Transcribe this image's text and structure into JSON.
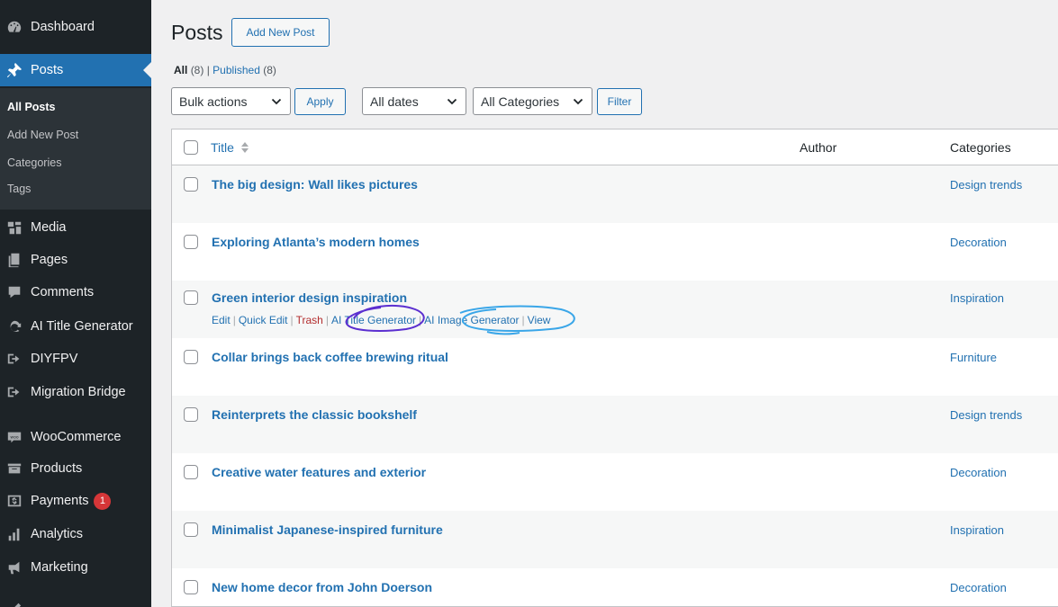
{
  "sidebar": {
    "items": [
      {
        "label": "Dashboard",
        "icon": "dashboard-icon"
      },
      {
        "label": "Posts",
        "icon": "pin-icon",
        "current": true
      },
      {
        "label": "Media",
        "icon": "media-icon"
      },
      {
        "label": "Pages",
        "icon": "pages-icon"
      },
      {
        "label": "Comments",
        "icon": "comments-icon"
      },
      {
        "label": "AI Title Generator",
        "icon": "refresh-icon"
      },
      {
        "label": "DIYFPV",
        "icon": "plugin-arrow-icon"
      },
      {
        "label": "Migration Bridge",
        "icon": "plugin-arrow-icon"
      },
      {
        "label": "WooCommerce",
        "icon": "woo-icon"
      },
      {
        "label": "Products",
        "icon": "archive-icon"
      },
      {
        "label": "Payments",
        "icon": "payments-icon",
        "badge": "1"
      },
      {
        "label": "Analytics",
        "icon": "analytics-icon"
      },
      {
        "label": "Marketing",
        "icon": "megaphone-icon"
      }
    ],
    "submenu": [
      "All Posts",
      "Add New Post",
      "Categories",
      "Tags"
    ]
  },
  "header": {
    "title": "Posts",
    "add_new_label": "Add New Post"
  },
  "views": {
    "all_label": "All",
    "all_count": "(8)",
    "separator": "|",
    "published_label": "Published",
    "published_count": "(8)"
  },
  "filters": {
    "bulk_actions": "Bulk actions",
    "apply_label": "Apply",
    "dates": "All dates",
    "categories": "All Categories",
    "filter_label": "Filter"
  },
  "table": {
    "columns": {
      "title": "Title",
      "author": "Author",
      "categories": "Categories"
    },
    "rows": [
      {
        "title": "The big design: Wall likes pictures",
        "category": "Design trends"
      },
      {
        "title": "Exploring Atlanta’s modern homes",
        "category": "Decoration"
      },
      {
        "title": "Green interior design inspiration",
        "category": "Inspiration"
      },
      {
        "title": "Collar brings back coffee brewing ritual",
        "category": "Furniture"
      },
      {
        "title": "Reinterprets the classic bookshelf",
        "category": "Design trends"
      },
      {
        "title": "Creative water features and exterior",
        "category": "Decoration"
      },
      {
        "title": "Minimalist Japanese-inspired furniture",
        "category": "Inspiration"
      },
      {
        "title": "New home decor from John Doerson",
        "category": "Decoration"
      }
    ],
    "row_actions": {
      "edit": "Edit",
      "quick_edit": "Quick Edit",
      "trash": "Trash",
      "ai_title": "AI Title Generator",
      "ai_image": "AI Image Generator",
      "view": "View"
    }
  },
  "colors": {
    "sidebar_bg": "#1d2327",
    "accent": "#2271b1",
    "annotation_purple": "#5b2fd0",
    "annotation_blue": "#3aa6e8",
    "badge_red": "#d63638"
  }
}
